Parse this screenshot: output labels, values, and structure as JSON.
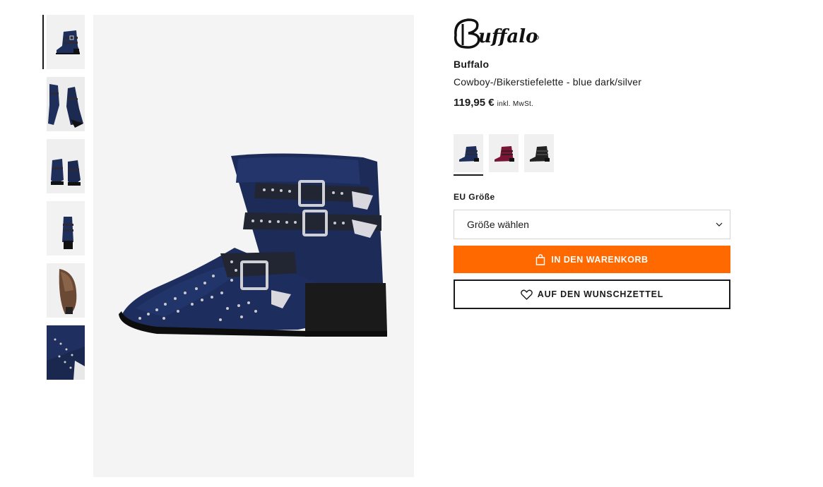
{
  "product": {
    "brand": "Buffalo",
    "logo_text": "Buffalo",
    "name": "Cowboy-/Bikerstiefelette - blue dark/silver",
    "price": "119,95 €",
    "vat_note": "inkl. MwSt."
  },
  "gallery": {
    "thumbnails": [
      {
        "view": "side-view",
        "active": true
      },
      {
        "view": "top-pair-view"
      },
      {
        "view": "front-pair-view"
      },
      {
        "view": "back-view"
      },
      {
        "view": "sole-view"
      },
      {
        "view": "detail-view"
      }
    ],
    "main_image_icon": "boot-photo"
  },
  "colors": {
    "swatches": [
      {
        "color_name": "blue dark",
        "hex": "#1f2f5c",
        "selected": true
      },
      {
        "color_name": "bordeaux",
        "hex": "#7a1535",
        "selected": false
      },
      {
        "color_name": "black",
        "hex": "#222222",
        "selected": false
      }
    ]
  },
  "size": {
    "label": "EU Größe",
    "placeholder_value": "Größe wählen"
  },
  "actions": {
    "cart_label": "IN DEN WARENKORB",
    "cart_icon": "shopping-bag-icon",
    "wishlist_label": "AUF DEN WUNSCHZETTEL",
    "wishlist_icon": "heart-icon"
  },
  "theme": {
    "accent": "#ff6900",
    "text": "#1a1a1a"
  }
}
